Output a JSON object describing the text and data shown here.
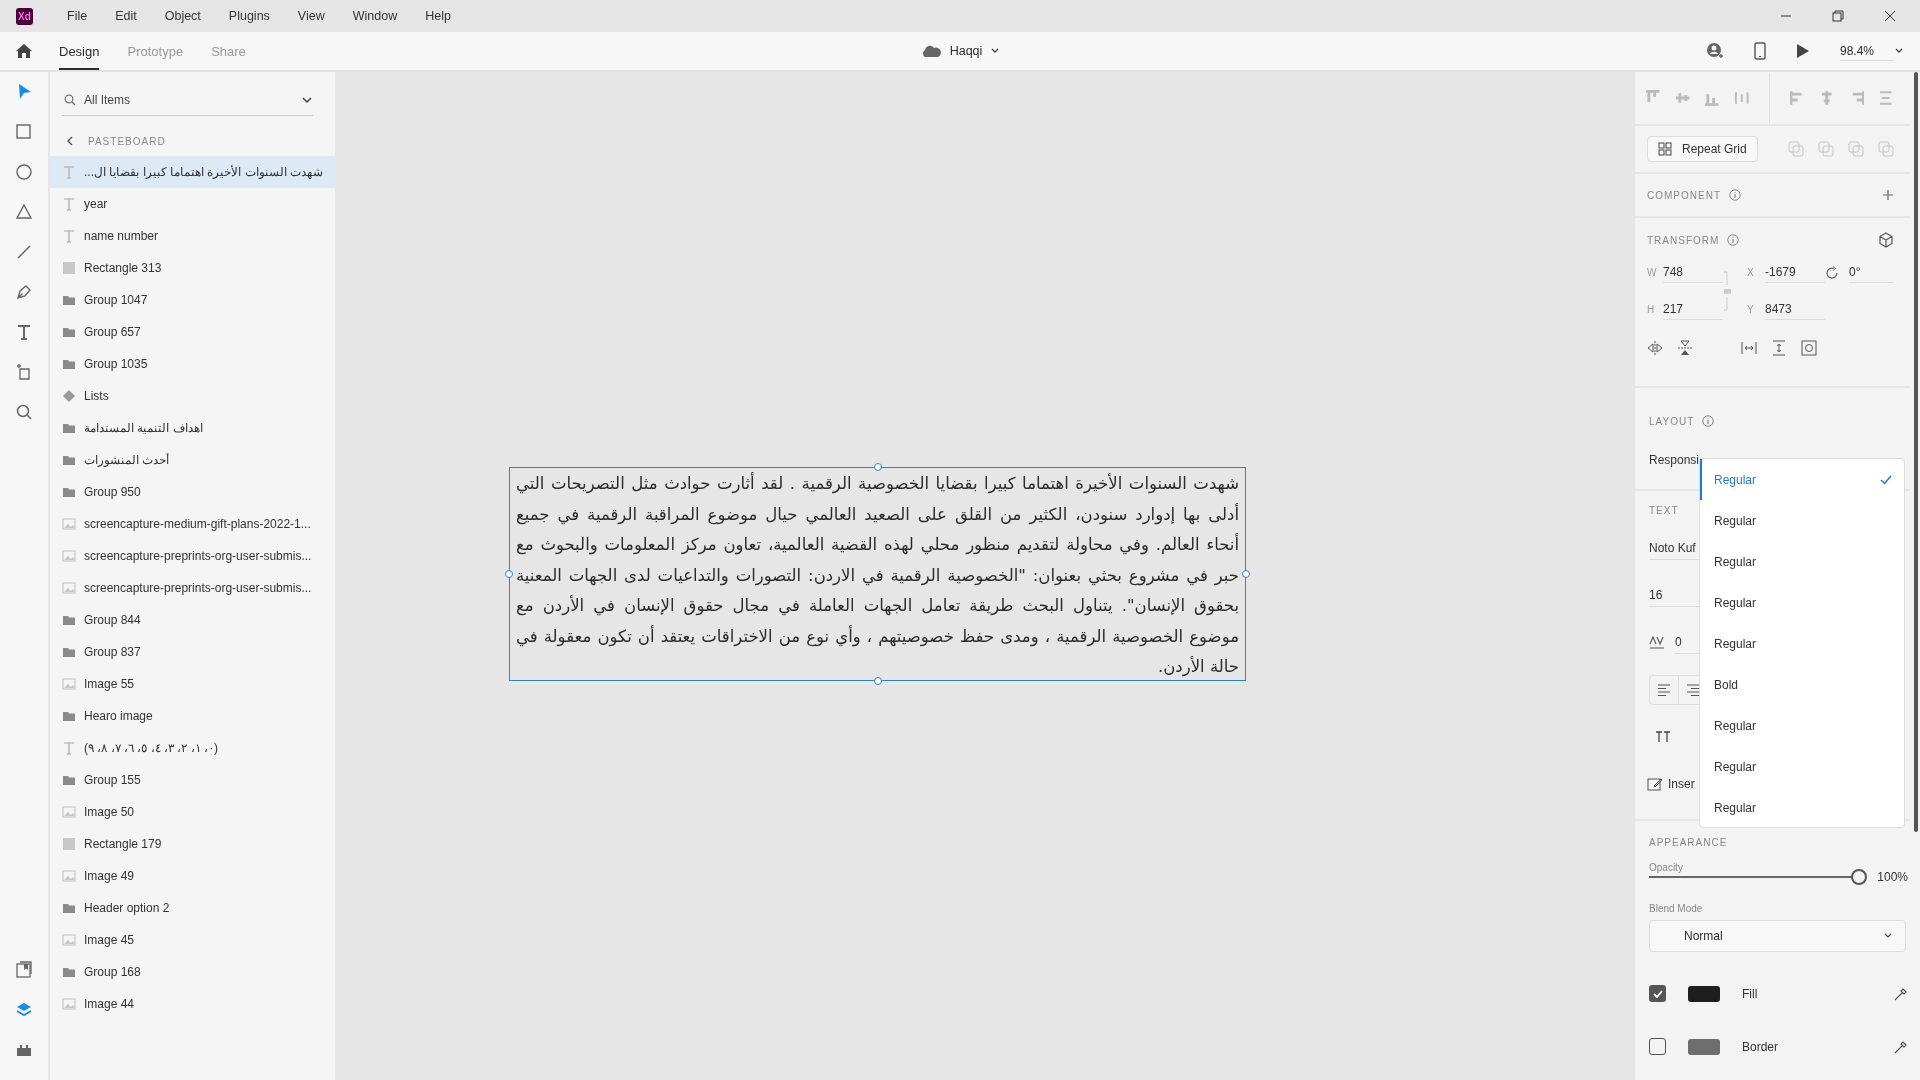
{
  "app": {
    "logo": "Xd"
  },
  "menu": [
    "File",
    "Edit",
    "Object",
    "Plugins",
    "View",
    "Window",
    "Help"
  ],
  "tabs": [
    {
      "label": "Design",
      "selected": true
    },
    {
      "label": "Prototype",
      "selected": false
    },
    {
      "label": "Share",
      "selected": false
    }
  ],
  "document": {
    "name": "Haqqi"
  },
  "zoom": "98.4%",
  "tools": [
    {
      "kind": "select",
      "selected": true
    },
    {
      "kind": "rectangle",
      "selected": false
    },
    {
      "kind": "ellipse",
      "selected": false
    },
    {
      "kind": "polygon",
      "selected": false
    },
    {
      "kind": "line",
      "selected": false
    },
    {
      "kind": "pen",
      "selected": false
    },
    {
      "kind": "text",
      "selected": false
    },
    {
      "kind": "artboard",
      "selected": false
    },
    {
      "kind": "zoom",
      "selected": false
    }
  ],
  "bottom_tools": [
    {
      "kind": "assets",
      "selected": false
    },
    {
      "kind": "layers",
      "selected": true
    },
    {
      "kind": "plugins",
      "selected": false
    }
  ],
  "layers": {
    "filter": "All Items",
    "breadcrumb": "PASTEBOARD",
    "items": [
      {
        "kind": "text",
        "name": "شهدت السنوات الأخيرة اهتماما كبيرا بقضايا ال...",
        "selected": true
      },
      {
        "kind": "text",
        "name": "year",
        "selected": false
      },
      {
        "kind": "text",
        "name": "name number",
        "selected": false
      },
      {
        "kind": "rectangle",
        "name": "Rectangle 313",
        "selected": false
      },
      {
        "kind": "group",
        "name": "Group 1047",
        "selected": false
      },
      {
        "kind": "group",
        "name": "Group 657",
        "selected": false
      },
      {
        "kind": "group",
        "name": "Group 1035",
        "selected": false
      },
      {
        "kind": "component",
        "name": "Lists",
        "selected": false
      },
      {
        "kind": "group",
        "name": "اهداف التنمية المستدامة",
        "selected": false
      },
      {
        "kind": "group",
        "name": "أحدث المنشورات",
        "selected": false
      },
      {
        "kind": "group",
        "name": "Group 950",
        "selected": false
      },
      {
        "kind": "image",
        "name": "screencapture-medium-gift-plans-2022-1...",
        "selected": false
      },
      {
        "kind": "image",
        "name": "screencapture-preprints-org-user-submis...",
        "selected": false
      },
      {
        "kind": "image",
        "name": "screencapture-preprints-org-user-submis...",
        "selected": false
      },
      {
        "kind": "group",
        "name": "Group 844",
        "selected": false
      },
      {
        "kind": "group",
        "name": "Group 837",
        "selected": false
      },
      {
        "kind": "image",
        "name": "Image 55",
        "selected": false
      },
      {
        "kind": "group",
        "name": "Hearo image",
        "selected": false
      },
      {
        "kind": "text",
        "name": "(٠، ١، ٢، ٣، ٤، ٥، ٦، ٧، ٨، ٩)",
        "selected": false
      },
      {
        "kind": "group",
        "name": "Group 155",
        "selected": false
      },
      {
        "kind": "image",
        "name": "Image 50",
        "selected": false
      },
      {
        "kind": "rectangle",
        "name": "Rectangle 179",
        "selected": false
      },
      {
        "kind": "image",
        "name": "Image 49",
        "selected": false
      },
      {
        "kind": "group",
        "name": "Header option 2",
        "selected": false
      },
      {
        "kind": "image",
        "name": "Image 45",
        "selected": false
      },
      {
        "kind": "group",
        "name": "Group 168",
        "selected": false
      },
      {
        "kind": "image",
        "name": "Image 44",
        "selected": false
      }
    ]
  },
  "canvas": {
    "text_lines": [
      "شهدت السنوات الأخيرة اهتماما كبيرا بقضايا الخصوصية الرقمية . لقد أثارت حوادث مثل التصريحات  التي",
      "أدلى بها إدوارد سنودن، الكثير من القلق على الصعيد العالمي حيال موضوع  المراقبة الرقمية في جميع",
      "أنحاء العالم. وفي محاولة لتقديم منظور محلي لهذه القضية العالمية، تعاون مركز المعلومات والبحوث مع",
      "حبر في مشروع بحثي بعنوان: \"الخصوصية الرقمية في الاردن: التصورات والتداعيات لدى الجهات المعنية",
      "بحقوق الإنسان\". يتناول البحث طريقة تعامل الجهات العاملة في مجال حقوق الإنسان في الأردن مع",
      "موضوع الخصوصية الرقمية ، ومدى حفظ خصوصيتهم ، وأي نوع من الاختراقات يعتقد أن تكون معقولة في",
      "حالة الأردن."
    ]
  },
  "properties": {
    "repeat_grid": "Repeat Grid",
    "component": {
      "title": "COMPONENT"
    },
    "transform": {
      "title": "TRANSFORM",
      "fields": [
        {
          "label": "W",
          "value": "748"
        },
        {
          "label": "X",
          "value": "-1679"
        },
        {
          "label": "H",
          "value": "217"
        },
        {
          "label": "Y",
          "value": "8473"
        }
      ],
      "rotation": "0°"
    },
    "layout": {
      "title": "LAYOUT",
      "responsive": "Responsi"
    },
    "text": {
      "title": "TEXT",
      "font": "Noto Kuf",
      "size": "16",
      "tracking": "0",
      "insert": "Inser"
    },
    "appearance": {
      "title": "APPEARANCE",
      "opacity_label": "Opacity",
      "opacity": {
        "level": 1
      },
      "opacity_reading": "100%",
      "blend_label": "Blend Mode",
      "blend": "Normal",
      "fill": {
        "label": "Fill",
        "checked": true
      },
      "border": {
        "label": "Border",
        "checked": false
      }
    }
  },
  "weight_menu": [
    {
      "label": "Regular",
      "selected": true
    },
    {
      "label": "Regular",
      "selected": false
    },
    {
      "label": "Regular",
      "selected": false
    },
    {
      "label": "Regular",
      "selected": false
    },
    {
      "label": "Regular",
      "selected": false
    },
    {
      "label": "Bold",
      "selected": false
    },
    {
      "label": "Regular",
      "selected": false
    },
    {
      "label": "Regular",
      "selected": false
    },
    {
      "label": "Regular",
      "selected": false
    }
  ]
}
